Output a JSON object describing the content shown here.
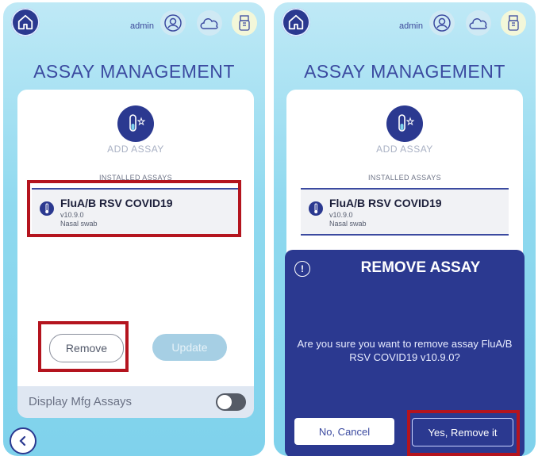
{
  "header": {
    "user": "admin",
    "icons": [
      "home-icon",
      "user-settings-icon",
      "cloud-icon",
      "usb-icon"
    ]
  },
  "page": {
    "title": "ASSAY MANAGEMENT"
  },
  "add_assay": {
    "label": "ADD ASSAY",
    "icon": "test-tube-star-icon"
  },
  "installed": {
    "heading": "INSTALLED ASSAYS",
    "items": [
      {
        "name": "FluA/B RSV COVID19",
        "version": "v10.9.0",
        "sample": "Nasal swab",
        "icon": "thermometer-icon"
      }
    ]
  },
  "actions": {
    "remove_label": "Remove",
    "update_label": "Update"
  },
  "display_mfg": {
    "label": "Display Mfg Assays",
    "on": false
  },
  "dialog": {
    "title": "REMOVE ASSAY",
    "message": "Are you sure you want to remove assay FluA/B RSV COVID19 v10.9.0?",
    "cancel_label": "No, Cancel",
    "confirm_label": "Yes, Remove it"
  },
  "colors": {
    "primary": "#2b3990",
    "highlight": "#b4141e",
    "background": "#8fd9ef"
  }
}
